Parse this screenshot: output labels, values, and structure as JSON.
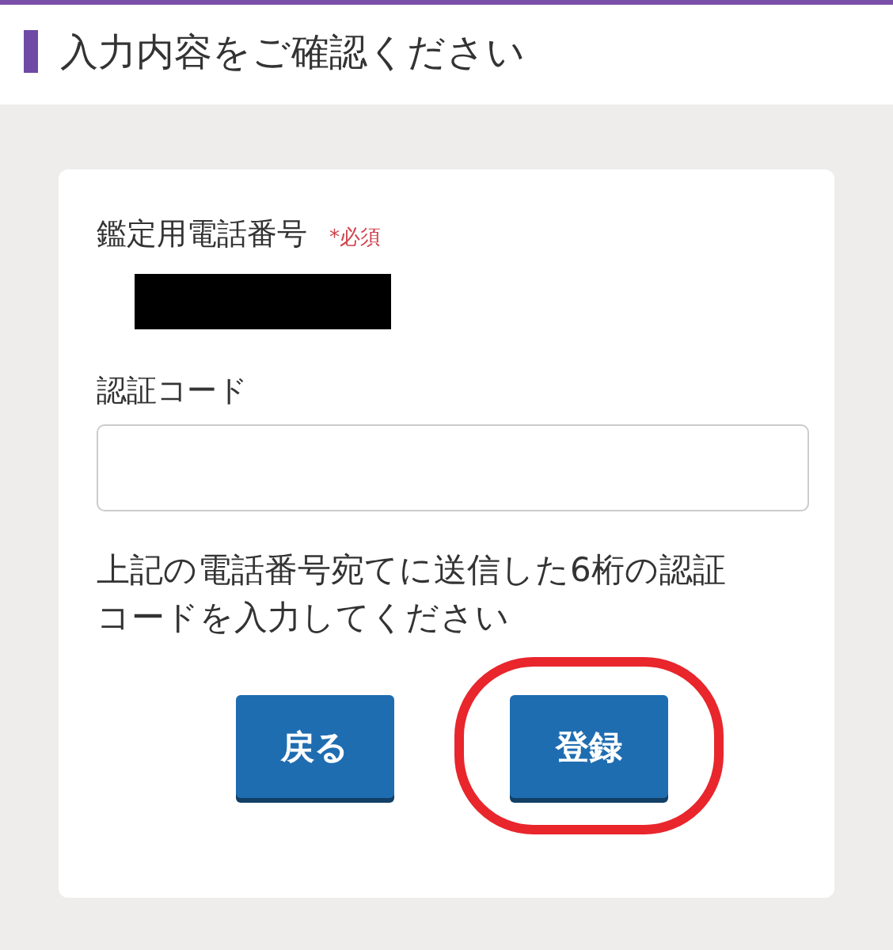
{
  "header": {
    "title": "入力内容をご確認ください"
  },
  "form": {
    "phone": {
      "label": "鑑定用電話番号",
      "required": "*必須",
      "redacted": true
    },
    "code": {
      "label": "認証コード"
    },
    "help": "上記の電話番号宛てに送信した6桁の認証コードを入力してください",
    "buttons": [
      {
        "label": "戻る"
      },
      {
        "label": "登録",
        "highlighted": true
      }
    ]
  }
}
